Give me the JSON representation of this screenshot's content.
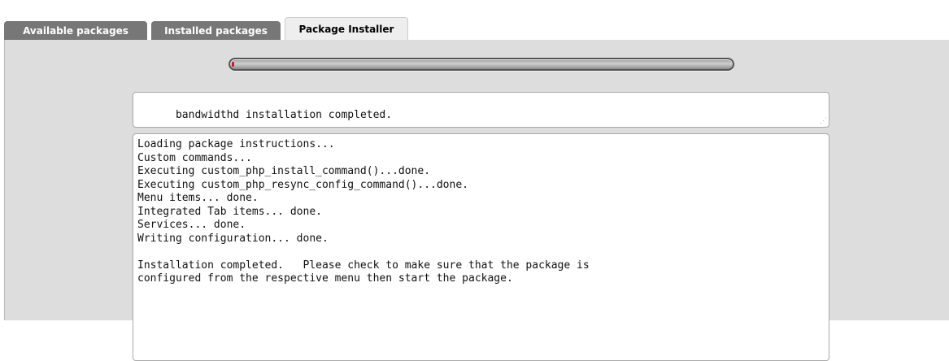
{
  "tabs": [
    {
      "label": "Available packages",
      "active": false
    },
    {
      "label": "Installed packages",
      "active": false
    },
    {
      "label": "Package Installer",
      "active": true
    }
  ],
  "progress": {
    "fraction": 0.005,
    "fill_color": "#c81c1c"
  },
  "status": {
    "text": "bandwidthd installation completed."
  },
  "log": {
    "lines": [
      "Loading package instructions...",
      "Custom commands...",
      "Executing custom_php_install_command()...done.",
      "Executing custom_php_resync_config_command()...done.",
      "Menu items... done.",
      "Integrated Tab items... done.",
      "Services... done.",
      "Writing configuration... done.",
      "",
      "Installation completed.   Please check to make sure that the package is",
      "configured from the respective menu then start the package."
    ]
  },
  "colors": {
    "tab_inactive_bg": "#777777",
    "tab_active_bg": "#eeeeee",
    "panel_bg": "#dddddd"
  }
}
